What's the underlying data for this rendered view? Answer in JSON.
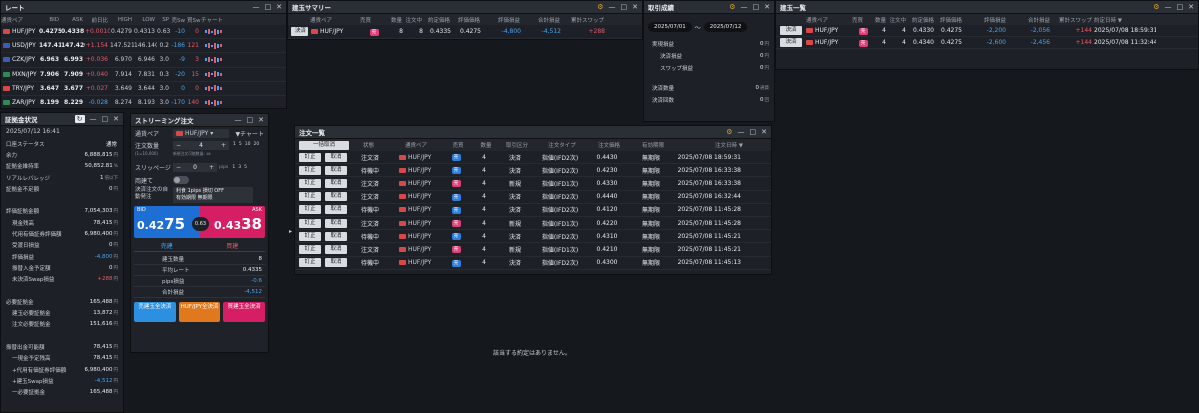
{
  "rate": {
    "title": "レート",
    "headers": [
      "通貨ペア",
      "BID",
      "ASK",
      "前日比",
      "HIGH",
      "LOW",
      "SP",
      "売Sw",
      "買Sw",
      "チャート"
    ],
    "rows": [
      {
        "pair": "HUF/JPY",
        "flag": "#d94848",
        "bid": "0.4275",
        "ask": "0.4338",
        "chg": "+0.0010",
        "high": "0.4279",
        "low": "0.4313",
        "sp": "0.63",
        "sw1": "-10",
        "sw2": "0",
        "dir": "pos"
      },
      {
        "pair": "USD/JPY",
        "flag": "#3b5bb5",
        "bid": "147.418",
        "ask": "147.420",
        "chg": "+1.154",
        "high": "147.521",
        "low": "146.140",
        "sp": "0.2",
        "sw1": "-186",
        "sw2": "121",
        "dir": "pos"
      },
      {
        "pair": "CZK/JPY",
        "flag": "#3b5bb5",
        "bid": "6.963",
        "ask": "6.993",
        "chg": "+0.036",
        "high": "6.970",
        "low": "6.946",
        "sp": "3.0",
        "sw1": "-9",
        "sw2": "3",
        "dir": "pos"
      },
      {
        "pair": "MXN/JPY",
        "flag": "#2e8b57",
        "bid": "7.906",
        "ask": "7.909",
        "chg": "+0.040",
        "high": "7.914",
        "low": "7.831",
        "sp": "0.3",
        "sw1": "-20",
        "sw2": "15",
        "dir": "pos"
      },
      {
        "pair": "TRY/JPY",
        "flag": "#d94848",
        "bid": "3.647",
        "ask": "3.677",
        "chg": "+0.027",
        "high": "3.649",
        "low": "3.644",
        "sp": "3.0",
        "sw1": "0",
        "sw2": "0",
        "dir": "pos"
      },
      {
        "pair": "ZAR/JPY",
        "flag": "#2e8b57",
        "bid": "8.199",
        "ask": "8.229",
        "chg": "-0.028",
        "high": "8.274",
        "low": "8.193",
        "sp": "3.0",
        "sw1": "-170",
        "sw2": "140",
        "dir": "neg"
      }
    ]
  },
  "margin": {
    "title": "証拠金状況",
    "date": "2025/07/12 16:41",
    "rows": [
      {
        "label": "口座ステータス",
        "value": "通常",
        "unit": "",
        "ind": 0,
        "cls": "wht"
      },
      {
        "label": "余力",
        "value": "6,888,815",
        "unit": "円",
        "ind": 0,
        "cls": "wht"
      },
      {
        "label": "証拠金維持率",
        "value": "50,852.81",
        "unit": "%",
        "ind": 0,
        "cls": "wht"
      },
      {
        "label": "リアルレバレッジ",
        "value": "1",
        "unit": "倍以下",
        "ind": 0,
        "cls": "wht"
      },
      {
        "label": "証拠金不足額",
        "value": "0",
        "unit": "円",
        "ind": 0,
        "cls": "wht"
      },
      {
        "label": "",
        "value": "",
        "unit": "",
        "ind": 0,
        "cls": "wht"
      },
      {
        "label": "評価証拠金額",
        "value": "7,054,303",
        "unit": "円",
        "ind": 0,
        "cls": "wht"
      },
      {
        "label": "現金残高",
        "value": "78,415",
        "unit": "円",
        "ind": 1,
        "cls": "wht"
      },
      {
        "label": "代用有価証券評価額",
        "value": "6,980,400",
        "unit": "円",
        "ind": 1,
        "cls": "wht"
      },
      {
        "label": "受渡日損益",
        "value": "0",
        "unit": "円",
        "ind": 1,
        "cls": "wht"
      },
      {
        "label": "評価損益",
        "value": "-4,800",
        "unit": "円",
        "ind": 1,
        "cls": "neg"
      },
      {
        "label": "振替入金予定額",
        "value": "0",
        "unit": "円",
        "ind": 1,
        "cls": "wht"
      },
      {
        "label": "未決済Swap損益",
        "value": "+288",
        "unit": "円",
        "ind": 1,
        "cls": "pos"
      },
      {
        "label": "",
        "value": "",
        "unit": "",
        "ind": 0,
        "cls": "wht"
      },
      {
        "label": "必要証拠金",
        "value": "165,488",
        "unit": "円",
        "ind": 0,
        "cls": "wht"
      },
      {
        "label": "建玉必要証拠金",
        "value": "13,872",
        "unit": "円",
        "ind": 1,
        "cls": "wht"
      },
      {
        "label": "注文必要証拠金",
        "value": "151,616",
        "unit": "円",
        "ind": 1,
        "cls": "wht"
      },
      {
        "label": "",
        "value": "",
        "unit": "",
        "ind": 0,
        "cls": "wht"
      },
      {
        "label": "振替出金可能額",
        "value": "78,415",
        "unit": "円",
        "ind": 0,
        "cls": "wht"
      },
      {
        "label": "一現金予定残高",
        "value": "78,415",
        "unit": "円",
        "ind": 1,
        "cls": "wht"
      },
      {
        "label": "+代用有価証券評価額",
        "value": "6,980,400",
        "unit": "円",
        "ind": 1,
        "cls": "wht"
      },
      {
        "label": "+建玉Swap損益",
        "value": "-4,512",
        "unit": "円",
        "ind": 1,
        "cls": "neg"
      },
      {
        "label": "一必要証拠金",
        "value": "165,488",
        "unit": "円",
        "ind": 1,
        "cls": "wht"
      }
    ]
  },
  "stream": {
    "title": "ストリーミング注文",
    "pair_label": "通貨ペア",
    "pair": "HUF/JPY",
    "chart_link": "▼チャート",
    "qty_label": "注文数量",
    "qty_sub": "(1=10,000)",
    "qty": "4",
    "qty_note": "新規注文可能数量: 18",
    "qty_opts": [
      "1",
      "5",
      "10",
      "20"
    ],
    "slip_label": "スリッページ",
    "slip": "0",
    "slip_unit": "pips",
    "slip_opts": [
      "1",
      "3",
      "5"
    ],
    "both_label": "両建て",
    "auto_label": "決済注文の自動発注",
    "auto_v1": "利食 1pips 損切 OFF",
    "auto_v2": "有効期限 無期限",
    "bid_label": "BID",
    "bid_big": "0.42",
    "bid_small": "75",
    "ask_label": "ASK",
    "ask_big": "0.43",
    "ask_small": "38",
    "spread": "0.63",
    "sell_tab": "売建",
    "buy_tab": "買建",
    "summary": [
      {
        "label": "建玉数量",
        "value": "8"
      },
      {
        "label": "平均レート",
        "value": "0.4335"
      },
      {
        "label": "pips損益",
        "value": "-0.6"
      },
      {
        "label": "合計損益",
        "value": "-4,512"
      }
    ],
    "btn_sell_all": "売建玉全決済",
    "btn_all": "HUF/JPY全決済",
    "btn_buy_all": "買建玉全決済"
  },
  "summaryPanel": {
    "title": "建玉サマリー",
    "headers": [
      "通貨ペア",
      "売買",
      "数量",
      "注文中",
      "約定価格",
      "評価価格",
      "評価損益",
      "合計損益",
      "累計スワップ"
    ],
    "rows": [
      {
        "btn": "決済",
        "pair": "HUF/JPY",
        "side": "売",
        "qty": "8",
        "ordering": "8",
        "price": "0.4335",
        "eval": "0.4275",
        "pnl": "-4,800",
        "total": "-4,512",
        "swap": "+288"
      }
    ]
  },
  "trade": {
    "title": "取引成績",
    "from": "2025/07/01",
    "sep": "〜",
    "to": "2025/07/12",
    "rows": [
      {
        "label": "実現損益",
        "value": "0",
        "unit": "円",
        "ind": 0
      },
      {
        "label": "決済損益",
        "value": "0",
        "unit": "円",
        "ind": 1
      },
      {
        "label": "スワップ損益",
        "value": "0",
        "unit": "円",
        "ind": 1
      },
      {
        "label": "決済数量",
        "value": "0",
        "unit": "通貨",
        "ind": 0
      },
      {
        "label": "決済回数",
        "value": "0",
        "unit": "回",
        "ind": 0
      }
    ]
  },
  "orders": {
    "title": "注文一覧",
    "cancel_all": "一括取消",
    "headers": [
      "状態",
      "通貨ペア",
      "売買",
      "数量",
      "取引区分",
      "注文タイプ",
      "注文価格",
      "有効期限",
      "注文日時 ▼"
    ],
    "btn_edit": "訂正",
    "btn_cancel": "取消",
    "rows": [
      {
        "status": "注文済",
        "pair": "HUF/JPY",
        "side": "売",
        "qty": "4",
        "kind": "決済",
        "type": "指値(IFD2次)",
        "price": "0.4430",
        "exp": "無期限",
        "date": "2025/07/08 18:59:31"
      },
      {
        "status": "待機中",
        "pair": "HUF/JPY",
        "side": "売",
        "qty": "4",
        "kind": "決済",
        "type": "指値(IFD2次)",
        "price": "0.4230",
        "exp": "無期限",
        "date": "2025/07/08 16:33:38"
      },
      {
        "status": "注文済",
        "pair": "HUF/JPY",
        "side": "売",
        "qty": "4",
        "kind": "新規",
        "type": "指値(IFD1次)",
        "price": "0.4330",
        "exp": "無期限",
        "date": "2025/07/08 16:33:38"
      },
      {
        "status": "注文済",
        "pair": "HUF/JPY",
        "side": "売",
        "qty": "4",
        "kind": "決済",
        "type": "指値(IFD2次)",
        "price": "0.4440",
        "exp": "無期限",
        "date": "2025/07/08 16:32:44"
      },
      {
        "status": "待機中",
        "pair": "HUF/JPY",
        "side": "売",
        "qty": "4",
        "kind": "決済",
        "type": "指値(IFD2次)",
        "price": "0.4120",
        "exp": "無期限",
        "date": "2025/07/08 11:45:28"
      },
      {
        "status": "注文済",
        "pair": "HUF/JPY",
        "side": "売",
        "qty": "4",
        "kind": "新規",
        "type": "指値(IFD1次)",
        "price": "0.4220",
        "exp": "無期限",
        "date": "2025/07/08 11:45:28"
      },
      {
        "status": "待機中",
        "pair": "HUF/JPY",
        "side": "売",
        "qty": "4",
        "kind": "決済",
        "type": "指値(IFD2次)",
        "price": "0.4310",
        "exp": "無期限",
        "date": "2025/07/08 11:45:21"
      },
      {
        "status": "注文済",
        "pair": "HUF/JPY",
        "side": "売",
        "qty": "4",
        "kind": "新規",
        "type": "指値(IFD1次)",
        "price": "0.4210",
        "exp": "無期限",
        "date": "2025/07/08 11:45:21"
      },
      {
        "status": "待機中",
        "pair": "HUF/JPY",
        "side": "売",
        "qty": "4",
        "kind": "決済",
        "type": "指値(IFD2次)",
        "price": "0.4300",
        "exp": "無期限",
        "date": "2025/07/08 11:45:13"
      }
    ]
  },
  "positions": {
    "title": "建玉一覧",
    "headers": [
      "通貨ペア",
      "売買",
      "数量",
      "注文中",
      "約定価格",
      "評価価格",
      "評価損益",
      "合計損益",
      "累計スワップ",
      "約定日時 ▼"
    ],
    "rows": [
      {
        "btn": "決済",
        "pair": "HUF/JPY",
        "side": "売",
        "qty": "4",
        "ordering": "4",
        "price": "0.4330",
        "eval": "0.4275",
        "pnl": "-2,200",
        "total": "-2,056",
        "swap": "+144",
        "date": "2025/07/08 18:59:31"
      },
      {
        "btn": "決済",
        "pair": "HUF/JPY",
        "side": "売",
        "qty": "4",
        "ordering": "4",
        "price": "0.4340",
        "eval": "0.4275",
        "pnl": "-2,600",
        "total": "-2,456",
        "swap": "+144",
        "date": "2025/07/08 11:32:44"
      }
    ]
  },
  "empty_msg": "該当する約定はありません。"
}
